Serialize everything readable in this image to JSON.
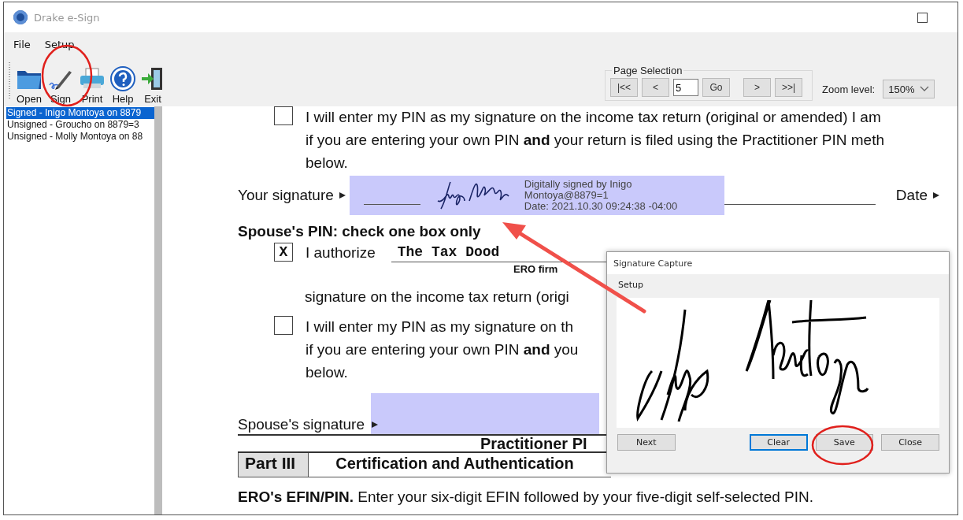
{
  "window": {
    "title": "Drake e-Sign"
  },
  "menu": [
    "File",
    "Setup"
  ],
  "toolbar": [
    {
      "kind": "folder",
      "label": "Open"
    },
    {
      "kind": "pen",
      "label": "Sign"
    },
    {
      "kind": "printer",
      "label": "Print"
    },
    {
      "kind": "help",
      "label": "Help"
    },
    {
      "kind": "exit",
      "label": "Exit"
    }
  ],
  "page_selection": {
    "title": "Page Selection",
    "first": "|<<",
    "previous": "<",
    "page": "5",
    "go": "Go",
    "next": ">",
    "last": ">>|"
  },
  "zoom": {
    "label": "Zoom level:",
    "value": "150%"
  },
  "documents": [
    {
      "label": "Signed - Inigo Montoya on 8879",
      "selected": true
    },
    {
      "label": "Unsigned - Groucho on 8879=3",
      "selected": false
    },
    {
      "label": "Unsigned - Molly Montoya on 88",
      "selected": false
    }
  ],
  "form": {
    "pin_option": {
      "checked": false,
      "lines": [
        "I will enter my PIN as my signature on the income tax return (original or amended) I am",
        "if you are entering your own PIN **and** your return is filed using the Practitioner PIN meth",
        "below."
      ]
    },
    "taxpayer_signature": {
      "label": "Your signature",
      "stamp": [
        "Digitally signed by Inigo",
        "Montoya@8879=1",
        "Date: 2021.10.30 09:24:38 -04:00"
      ],
      "date_label": "Date"
    },
    "spouse_heading": "Spouse's PIN: check one box only",
    "spouse_options": [
      {
        "kind": "authorize",
        "checked": true,
        "check_mark": "X",
        "label": "I authorize",
        "ero_name": "The Tax Dood",
        "ero_caption": "ERO firm",
        "continuation": "signature on the income tax return (origi"
      },
      {
        "kind": "self_pin",
        "checked": false,
        "lines": [
          "I will enter my PIN as my signature on th",
          "if you are entering your own PIN **and** you",
          "below."
        ]
      }
    ],
    "spouse_signature": {
      "label": "Spouse's signature"
    },
    "section_title": "Practitioner PI",
    "part": {
      "number": "Part III",
      "title": "Certification and Authentication"
    },
    "ero_efin": "**ERO's EFIN/PIN.** Enter your six-digit EFIN followed by your five-digit self-selected PIN."
  },
  "dialog": {
    "title": "Signature Capture",
    "menu": [
      "Setup"
    ],
    "buttons": [
      {
        "label": "Next",
        "focused": false
      },
      {
        "label": "Clear",
        "focused": true
      },
      {
        "label": "Save",
        "focused": false
      },
      {
        "label": "Close",
        "focused": false
      }
    ]
  }
}
